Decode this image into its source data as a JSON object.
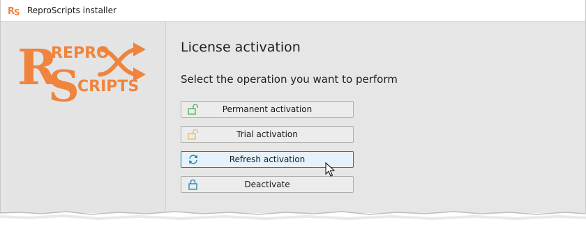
{
  "window": {
    "title": "ReproScripts installer",
    "app_icon": "rs-logo-icon"
  },
  "logo": {
    "text_repro": "REPRO",
    "text_scripts": "CRIPTS",
    "letters": "RS",
    "color": "#f0843c"
  },
  "main": {
    "heading": "License activation",
    "subheading": "Select the operation you want to perform"
  },
  "operations": [
    {
      "label": "Permanent activation",
      "icon": "unlock-icon",
      "icon_color": "#4caf50"
    },
    {
      "label": "Trial activation",
      "icon": "unlock-icon",
      "icon_color": "#f0b94a"
    },
    {
      "label": "Refresh activation",
      "icon": "refresh-icon",
      "icon_color": "#1e82b4",
      "state": "hover"
    },
    {
      "label": "Deactivate",
      "icon": "lock-icon",
      "icon_color": "#1e82b4"
    }
  ],
  "colors": {
    "accent": "#0078d7",
    "hover_bg": "#e5f1fb"
  }
}
